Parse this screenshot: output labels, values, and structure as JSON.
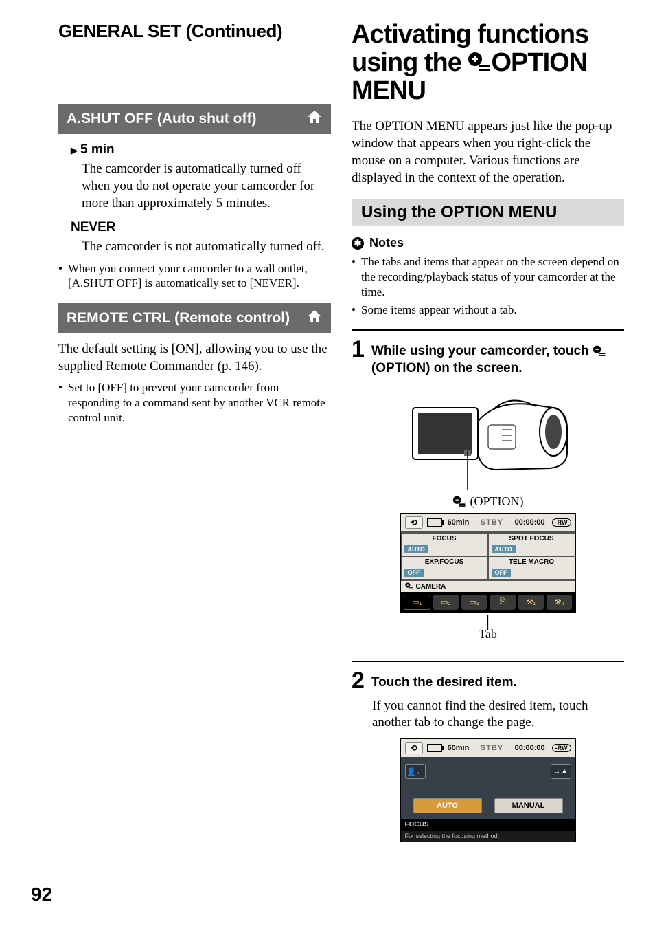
{
  "left": {
    "section_title": "GENERAL SET (Continued)",
    "feature1": {
      "title": "A.SHUT OFF (Auto shut off)",
      "opt1_label": "5 min",
      "opt1_desc": "The camcorder is automatically turned off when you do not operate your camcorder for more than approximately 5 minutes.",
      "opt2_label": "NEVER",
      "opt2_desc": "The camcorder is not automatically turned off.",
      "note1": "When you connect your camcorder to a wall outlet, [A.SHUT OFF] is automatically set to [NEVER]."
    },
    "feature2": {
      "title": "REMOTE CTRL (Remote control)",
      "desc": "The default setting is [ON], allowing you to use the supplied Remote Commander (p. 146).",
      "note1": "Set to [OFF] to prevent your camcorder from responding to a command sent by another VCR remote control unit."
    }
  },
  "right": {
    "title_a": "Activating functions using the ",
    "title_b": "OPTION MENU",
    "intro": "The OPTION MENU appears just like the pop-up window that appears when you right-click the mouse on a computer. Various functions are displayed in the context of the operation.",
    "subhead": "Using the OPTION MENU",
    "notes_label": "Notes",
    "note1": "The tabs and items that appear on the screen depend on the recording/playback status of your camcorder at the time.",
    "note2": "Some items appear without a tab.",
    "step1_num": "1",
    "step1_text_a": "While using your camcorder, touch ",
    "step1_text_b": "(OPTION) on the screen.",
    "option_caption": "(OPTION)",
    "lcd1": {
      "time": "60min",
      "stby": "STBY",
      "tc": "00:00:00",
      "rw": "-RW",
      "cells": [
        {
          "lbl": "FOCUS",
          "val": "AUTO"
        },
        {
          "lbl": "SPOT FOCUS",
          "val": "AUTO"
        },
        {
          "lbl": "EXP.FOCUS",
          "val": "OFF"
        },
        {
          "lbl": "TELE MACRO",
          "val": "OFF"
        }
      ],
      "cat": "CAMERA"
    },
    "tab_caption": "Tab",
    "step2_num": "2",
    "step2_text": "Touch the desired item.",
    "step2_body": "If you cannot find the desired item, touch another tab to change the page.",
    "lcd2": {
      "time": "60min",
      "stby": "STBY",
      "tc": "00:00:00",
      "rw": "-RW",
      "auto": "AUTO",
      "manual": "MANUAL",
      "focus": "FOCUS",
      "hint": "For selecting the focusing method."
    }
  },
  "page_number": "92"
}
